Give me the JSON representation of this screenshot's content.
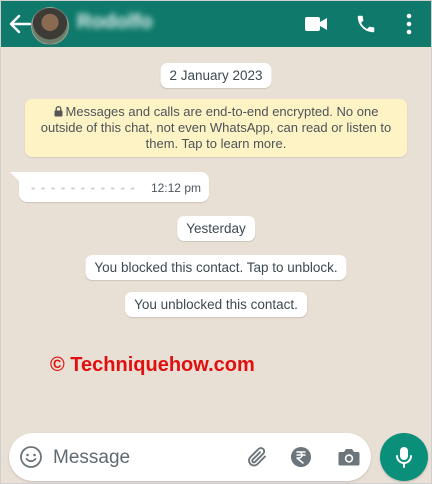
{
  "header": {
    "contact_name": "Rodolfo",
    "icons": {
      "back": "arrow-left",
      "video": "video-camera",
      "call": "phone",
      "menu": "vertical-dots"
    },
    "color": "#0f7a6b"
  },
  "chat": {
    "date_pill": "2 January 2023",
    "encryption_notice": "Messages and calls are end-to-end encrypted. No one outside of this chat, not even WhatsApp, can read or listen to them. Tap to learn more.",
    "messages": [
      {
        "text": "- - - - - -  - - - - -",
        "time": "12:12 pm",
        "direction": "incoming"
      }
    ],
    "yesterday_pill": "Yesterday",
    "system_messages": [
      "You blocked this contact. Tap to unblock.",
      "You unblocked this contact."
    ]
  },
  "watermark": "© Techniquehow.com",
  "composer": {
    "placeholder": "Message",
    "value": "",
    "icons": [
      "emoji",
      "paperclip",
      "rupee",
      "camera",
      "microphone"
    ],
    "send_button_color": "#0a8f7b"
  }
}
